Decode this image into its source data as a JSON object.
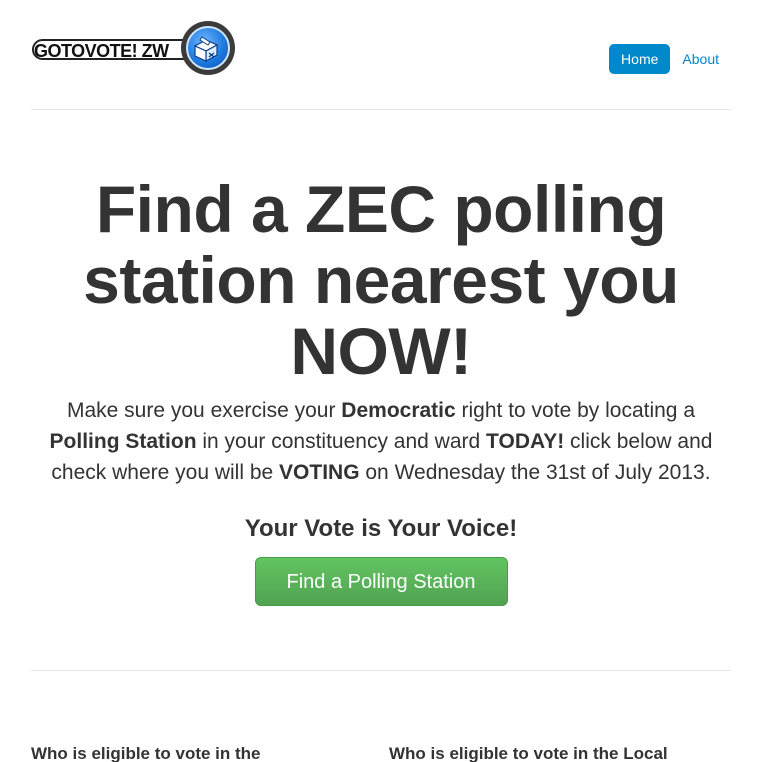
{
  "header": {
    "logo_text": "GOTOVOTE! ZW",
    "logo_icon": "ballot-box-icon",
    "nav": [
      {
        "label": "Home",
        "active": true
      },
      {
        "label": "About",
        "active": false
      }
    ]
  },
  "jumbotron": {
    "headline_line1": "Find a ZEC polling",
    "headline_line2": "station nearest you",
    "headline_line3": "NOW!",
    "lead": {
      "p1": "Make sure you exercise your ",
      "b1": "Democratic",
      "p2": " right to vote by locating a ",
      "b2": "Polling Station",
      "p3": " in your constituency and ward ",
      "b3": "TODAY!",
      "p4": " click below and check where you will be ",
      "b4": "VOTING",
      "p5": " on Wednesday the 31st of July 2013."
    },
    "tagline": "Your Vote is Your Voice!",
    "cta_label": "Find a Polling Station"
  },
  "columns": [
    {
      "title": "Who is eligible to vote in the"
    },
    {
      "title": "Who is eligible to vote in the Local"
    }
  ],
  "colors": {
    "nav_active": "#0088cc",
    "link": "#0088cc",
    "cta_green": "#5bb75b",
    "text": "#333333"
  }
}
